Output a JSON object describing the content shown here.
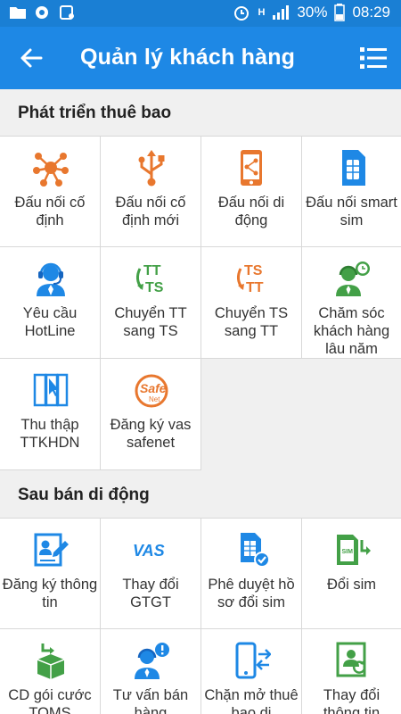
{
  "status_bar": {
    "battery": "30%",
    "time": "08:29",
    "network": "H"
  },
  "header": {
    "title": "Quản lý khách hàng"
  },
  "sections": [
    {
      "title": "Phát triển thuê bao",
      "items": [
        {
          "label": "Đấu nối cố định",
          "icon": "network-nodes-icon"
        },
        {
          "label": "Đấu nối cố định mới",
          "icon": "usb-icon"
        },
        {
          "label": "Đấu nối di động",
          "icon": "mobile-share-icon"
        },
        {
          "label": "Đấu nối smart sim",
          "icon": "sim-card-icon"
        },
        {
          "label": "Yêu cầu HotLine",
          "icon": "headset-agent-icon"
        },
        {
          "label": "Chuyển TT sang TS",
          "icon": "tt-ts-icon"
        },
        {
          "label": "Chuyển TS sang TT",
          "icon": "ts-tt-icon"
        },
        {
          "label": "Chăm sóc khách hàng lâu năm",
          "icon": "agent-clock-icon"
        },
        {
          "label": "Thu thập TTKHDN",
          "icon": "documents-cursor-icon"
        },
        {
          "label": "Đăng ký vas safenet",
          "icon": "safenet-logo-icon"
        }
      ]
    },
    {
      "title": "Sau bán di động",
      "items": [
        {
          "label": "Đăng ký thông tin",
          "icon": "profile-edit-icon"
        },
        {
          "label": "Thay đổi GTGT",
          "icon": "vas-icon"
        },
        {
          "label": "Phê duyệt hồ sơ đổi sim",
          "icon": "sim-approve-icon"
        },
        {
          "label": "Đổi sim",
          "icon": "sim-swap-icon"
        },
        {
          "label": "CD gói cước TOMS",
          "icon": "package-icon"
        },
        {
          "label": "Tư vấn bán hàng",
          "icon": "agent-alert-icon"
        },
        {
          "label": "Chặn mở thuê bao di",
          "icon": "phone-transfer-icon"
        },
        {
          "label": "Thay đổi thông tin",
          "icon": "id-card-icon"
        }
      ]
    }
  ]
}
